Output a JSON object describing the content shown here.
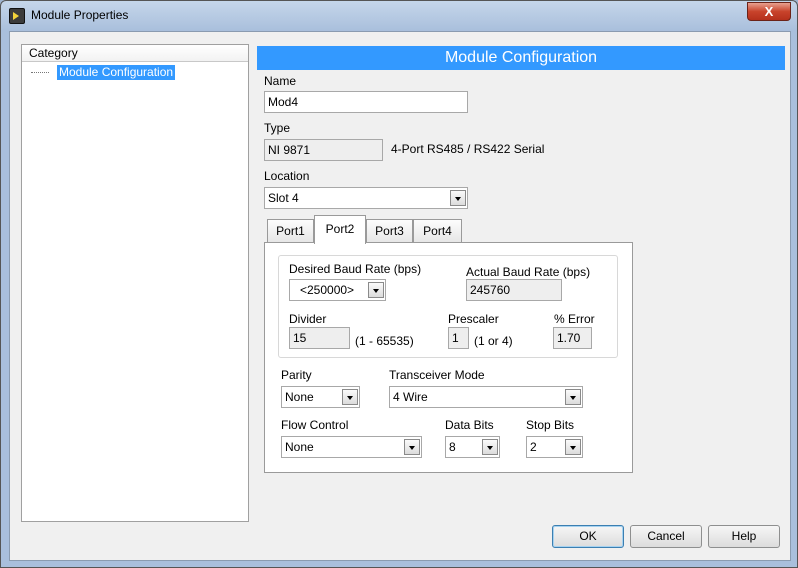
{
  "window": {
    "title": "Module Properties",
    "close_label": "X"
  },
  "category": {
    "header": "Category",
    "items": [
      {
        "label": "Module Configuration",
        "selected": true
      }
    ]
  },
  "section": {
    "title": "Module Configuration"
  },
  "name": {
    "label": "Name",
    "value": "Mod4"
  },
  "type": {
    "label": "Type",
    "value": "NI 9871",
    "description": "4-Port RS485 / RS422 Serial"
  },
  "location": {
    "label": "Location",
    "value": "Slot 4"
  },
  "tabs": [
    {
      "label": "Port1",
      "active": false
    },
    {
      "label": "Port2",
      "active": true
    },
    {
      "label": "Port3",
      "active": false
    },
    {
      "label": "Port4",
      "active": false
    }
  ],
  "port": {
    "desired_baud": {
      "label": "Desired Baud Rate (bps)",
      "value": "<250000>"
    },
    "actual_baud": {
      "label": "Actual Baud Rate (bps)",
      "value": "245760"
    },
    "divider": {
      "label": "Divider",
      "value": "15",
      "range": "(1 - 65535)"
    },
    "prescaler": {
      "label": "Prescaler",
      "value": "1",
      "range": "(1 or 4)"
    },
    "error": {
      "label": "% Error",
      "value": "1.70"
    },
    "parity": {
      "label": "Parity",
      "value": "None"
    },
    "transceiver": {
      "label": "Transceiver Mode",
      "value": "4 Wire"
    },
    "flow_control": {
      "label": "Flow Control",
      "value": "None"
    },
    "data_bits": {
      "label": "Data Bits",
      "value": "8"
    },
    "stop_bits": {
      "label": "Stop Bits",
      "value": "2"
    }
  },
  "buttons": {
    "ok": "OK",
    "cancel": "Cancel",
    "help": "Help"
  },
  "colors": {
    "accent": "#3399ff"
  },
  "icons": {
    "app": "labview-app-icon",
    "dropdown": "chevron-down-icon"
  }
}
